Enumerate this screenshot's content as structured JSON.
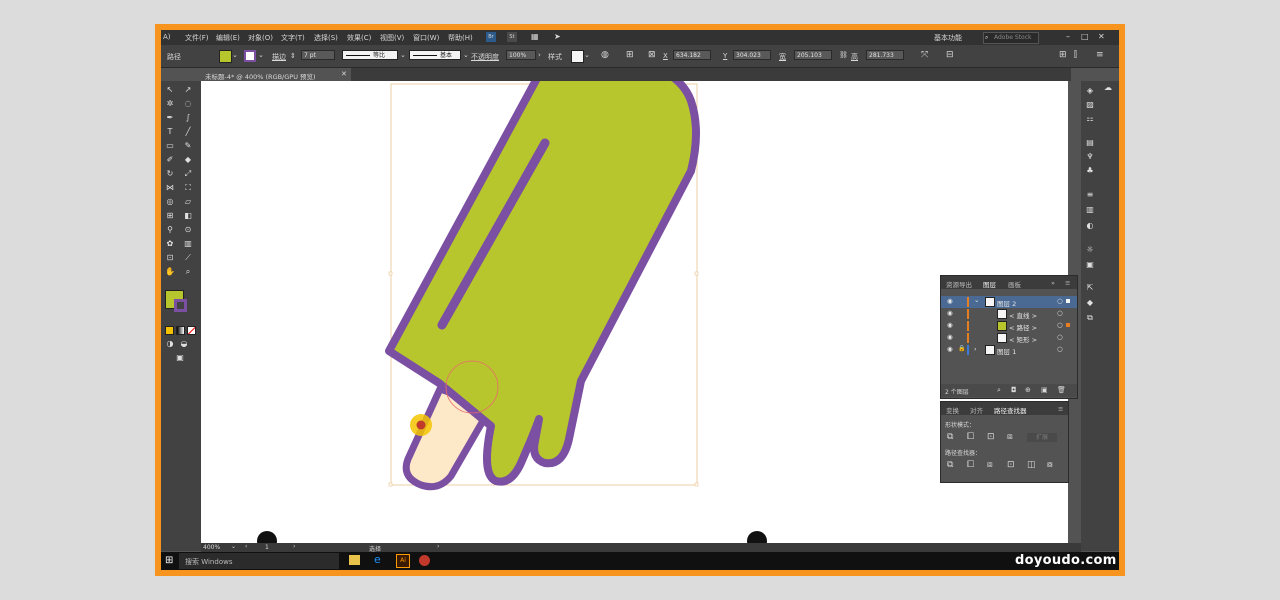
{
  "menu": {
    "items": [
      "A)",
      "文件(F)",
      "编辑(E)",
      "对象(O)",
      "文字(T)",
      "选择(S)",
      "效果(C)",
      "视图(V)",
      "窗口(W)",
      "帮助(H)"
    ],
    "badges": [
      "Br",
      "St"
    ],
    "workspace": "基本功能",
    "search_placeholder": "Adobe Stock"
  },
  "control": {
    "object_type": "路径",
    "stroke_label": "描边",
    "stroke_value": "7 pt",
    "profile_label": "等比",
    "brush_label": "基本",
    "opacity_label": "不透明度",
    "opacity_value": "100%",
    "style_label": "样式",
    "x_label": "X",
    "x_value": "634.182",
    "y_label": "Y",
    "y_value": "304.023",
    "w_label": "宽",
    "w_value": "205.103",
    "h_label": "高",
    "h_value": "281.733"
  },
  "document": {
    "tab_title": "未标题-4* @ 400% (RGB/GPU 预览)"
  },
  "colors": {
    "fill": "#b8c62e",
    "stroke": "#7b4fa2",
    "frame": "#f7941d",
    "stick": "#fde8c8"
  },
  "layers_panel": {
    "tabs": [
      "资源导出",
      "图层",
      "画板"
    ],
    "active_tab": "图层",
    "rows": [
      {
        "name": "图层 2"
      },
      {
        "name": "< 直线 >"
      },
      {
        "name": "< 路径 >"
      },
      {
        "name": "< 矩形 >"
      },
      {
        "name": "图层 1"
      }
    ],
    "footer": "2 个图层"
  },
  "pathfinder_panel": {
    "tabs": [
      "变换",
      "对齐",
      "路径查找器"
    ],
    "active_tab": "路径查找器",
    "shape_modes_label": "形状模式：",
    "expand_label": "扩展",
    "pathfinders_label": "路径查找器："
  },
  "status": {
    "zoom": "400%",
    "artboard": "1",
    "tool_name": "选择"
  },
  "taskbar": {
    "search": "搜索 Windows"
  },
  "watermark": "doyoudo.com"
}
